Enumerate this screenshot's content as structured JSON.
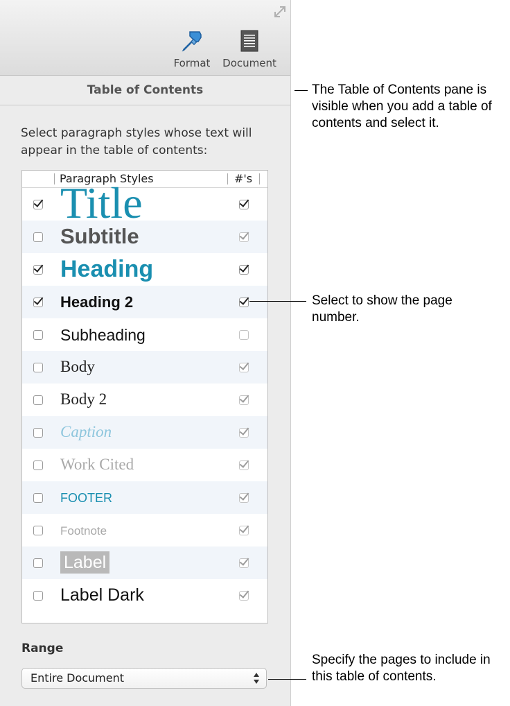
{
  "toolbar": {
    "format_label": "Format",
    "document_label": "Document"
  },
  "pane": {
    "title": "Table of Contents",
    "description": "Select paragraph styles whose text will appear in the table of contents:"
  },
  "table": {
    "col_styles": "Paragraph Styles",
    "col_numbers": "#'s",
    "rows": [
      {
        "label": "Title",
        "include": true,
        "page_number": true
      },
      {
        "label": "Subtitle",
        "include": false,
        "page_number": true
      },
      {
        "label": "Heading",
        "include": true,
        "page_number": true
      },
      {
        "label": "Heading 2",
        "include": true,
        "page_number": true
      },
      {
        "label": "Subheading",
        "include": false,
        "page_number": false
      },
      {
        "label": "Body",
        "include": false,
        "page_number": true
      },
      {
        "label": "Body 2",
        "include": false,
        "page_number": true
      },
      {
        "label": "Caption",
        "include": false,
        "page_number": true
      },
      {
        "label": "Work Cited",
        "include": false,
        "page_number": true
      },
      {
        "label": "FOOTER",
        "include": false,
        "page_number": true
      },
      {
        "label": "Footnote",
        "include": false,
        "page_number": true
      },
      {
        "label": "Label",
        "include": false,
        "page_number": true
      },
      {
        "label": "Label Dark",
        "include": false,
        "page_number": true
      }
    ]
  },
  "range": {
    "label": "Range",
    "selected": "Entire Document"
  },
  "callouts": {
    "pane": "The Table of Contents pane is visible when you add a table of contents and select it.",
    "page_number": "Select to show the page number.",
    "range": "Specify the pages to include in this table of contents."
  },
  "colors": {
    "accent_teal": "#1a8fb0",
    "format_icon_blue": "#3b8fd6"
  }
}
